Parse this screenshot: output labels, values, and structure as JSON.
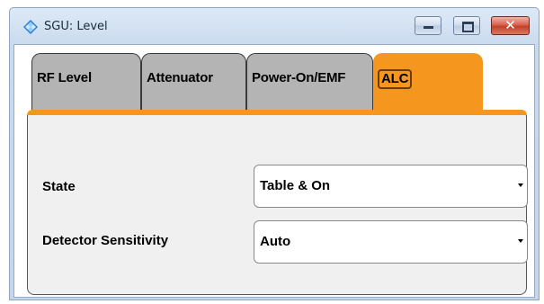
{
  "window": {
    "title": "SGU: Level"
  },
  "tabs": [
    {
      "label": "RF Level"
    },
    {
      "label": "Attenuator"
    },
    {
      "label": "Power-On/EMF"
    },
    {
      "label": "ALC",
      "active": true
    }
  ],
  "alc": {
    "state": {
      "label": "State",
      "value": "Table & On"
    },
    "detector_sensitivity": {
      "label": "Detector Sensitivity",
      "value": "Auto"
    }
  },
  "colors": {
    "active_tab": "#f5971e",
    "inactive_tab": "#b4b4b4",
    "close_button": "#c2402a"
  },
  "icons": {
    "title": "rs-diamond-icon",
    "minimize": "minimize-icon",
    "maximize": "maximize-icon",
    "close": "close-icon",
    "dropdown": "dropdown-arrow-icon"
  }
}
